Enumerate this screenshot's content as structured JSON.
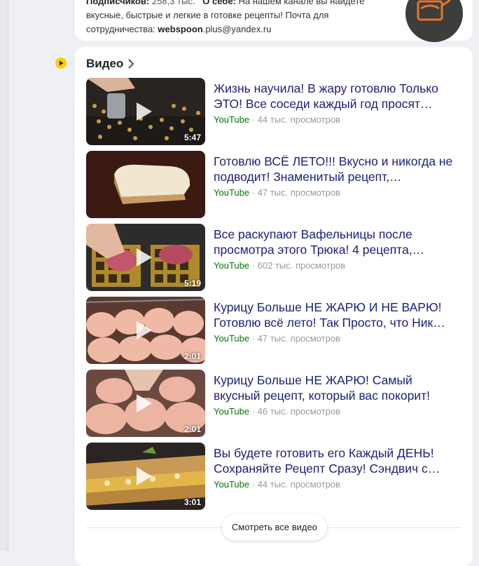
{
  "channel": {
    "subscribers_label": "Подписчиков:",
    "subscribers_value": "258,3 тыс.",
    "about_label": "О себе:",
    "about_text": "На нашем канале вы найдете вкусные, быстрые и легкие в готовке рецепты! Почта для сотрудничества:",
    "email_bold": "webspoon",
    "email_rest": ".plus@yandex.ru"
  },
  "videos_section": {
    "title": "Видео",
    "show_all_label": "Смотреть все видео",
    "items": [
      {
        "title": "Жизнь научила! В жару готовлю Только ЭТО! Все соседи каждый год просят…",
        "source": "YouTube",
        "views": "44 тыс. просмотров",
        "duration": "5:47"
      },
      {
        "title": "Готовлю ВСЁ ЛЕТО!!! Вкусно и никогда не подводит! Знаменитый рецепт,…",
        "source": "YouTube",
        "views": "47 тыс. просмотров",
        "duration": ""
      },
      {
        "title": "Все раскупают Вафельницы после просмотра этого Трюка! 4 рецепта,…",
        "source": "YouTube",
        "views": "602 тыс. просмотров",
        "duration": "5:19"
      },
      {
        "title": "Курицу Больше НЕ ЖАРЮ И НЕ ВАРЮ! Готовлю всё лето! Так Просто, что Ник…",
        "source": "YouTube",
        "views": "47 тыс. просмотров",
        "duration": "2:01"
      },
      {
        "title": "Курицу Больше НЕ ЖАРЮ! Самый вкусный рецепт, который вас покорит!",
        "source": "YouTube",
        "views": "46 тыс. просмотров",
        "duration": "2:01"
      },
      {
        "title": "Вы будете готовить его Каждый ДЕНЬ! Сохраняйте Рецепт Сразу! Сэндвич с…",
        "source": "YouTube",
        "views": "44 тыс. просмотров",
        "duration": "3:01"
      }
    ]
  },
  "separator": " · "
}
